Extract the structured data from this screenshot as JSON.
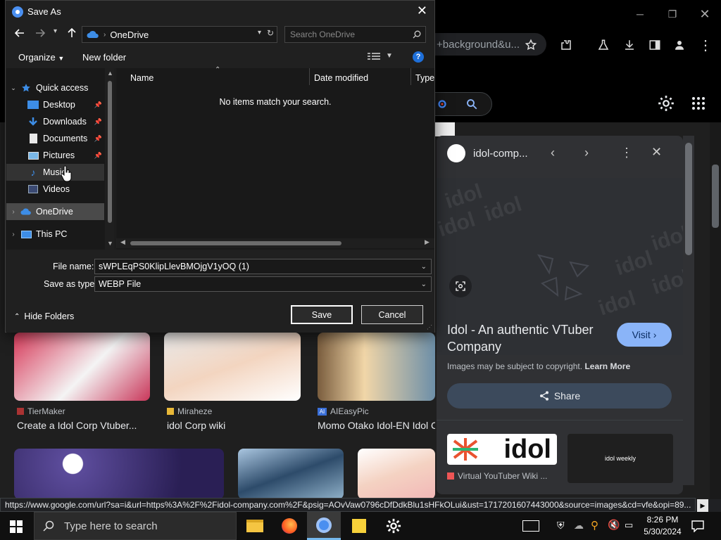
{
  "browser": {
    "omnibox_text": "+background&u...",
    "page_scroll_hint": ""
  },
  "panel": {
    "site_name": "idol-comp...",
    "headline": "Idol - An authentic VTuber Company",
    "visit_label": "Visit",
    "copyright_text": "Images may be subject to copyright.",
    "learn_more": "Learn More",
    "share_label": "Share",
    "related": [
      {
        "caption": "Virtual YouTuber Wiki ...",
        "logo_text": "idol"
      },
      {
        "caption": "",
        "logo_text": "idol weekly"
      }
    ],
    "watermark": "idol"
  },
  "results": [
    {
      "source": "TierMaker",
      "title": "Create a Idol Corp Vtuber..."
    },
    {
      "source": "Miraheze",
      "title": "idol Corp wiki"
    },
    {
      "source": "AIEasyPic",
      "title": "Momo Otako Idol-EN Idol C"
    }
  ],
  "status_url": "https://www.google.com/url?sa=i&url=https%3A%2F%2Fidol-company.com%2F&psig=AOvVaw0796cDfDdkBlu1sHFkOLui&ust=1717201607443000&source=images&cd=vfe&opi=89...",
  "dialog": {
    "title": "Save As",
    "location": "OneDrive",
    "search_placeholder": "Search OneDrive",
    "organize_label": "Organize",
    "new_folder_label": "New folder",
    "nav": {
      "quick_access": "Quick access",
      "items": [
        {
          "label": "Desktop",
          "pinned": true
        },
        {
          "label": "Downloads",
          "pinned": true
        },
        {
          "label": "Documents",
          "pinned": true
        },
        {
          "label": "Pictures",
          "pinned": true
        },
        {
          "label": "Music",
          "pinned": false
        },
        {
          "label": "Videos",
          "pinned": false
        }
      ],
      "onedrive": "OneDrive",
      "this_pc": "This PC"
    },
    "columns": {
      "name": "Name",
      "date": "Date modified",
      "type": "Type"
    },
    "empty_message": "No items match your search.",
    "file_name_label": "File name:",
    "file_name_value": "sWPLEqPS0KlipLlevBMOjgV1yOQ (1)",
    "save_type_label": "Save as type:",
    "save_type_value": "WEBP File",
    "hide_folders_label": "Hide Folders",
    "save_label": "Save",
    "cancel_label": "Cancel"
  },
  "taskbar": {
    "search_placeholder": "Type here to search",
    "time": "8:26 PM",
    "date": "5/30/2024"
  }
}
